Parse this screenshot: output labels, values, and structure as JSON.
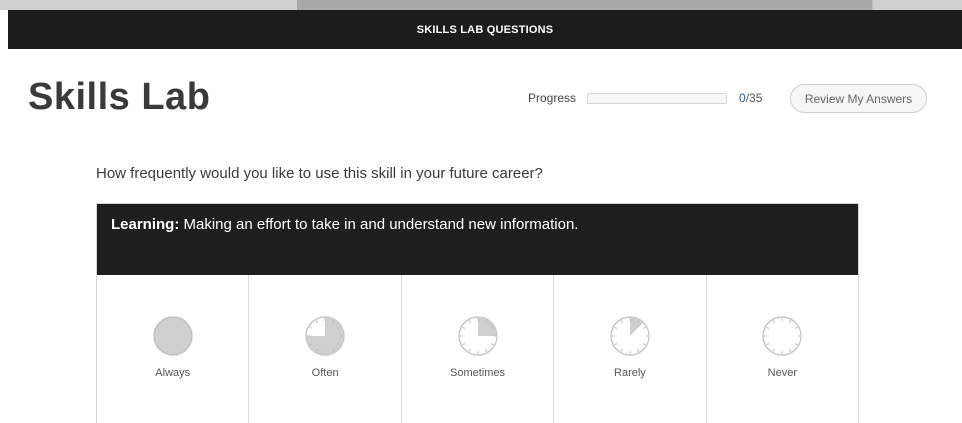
{
  "header": {
    "title": "SKILLS LAB QUESTIONS"
  },
  "page": {
    "title": "Skills Lab"
  },
  "progress": {
    "label": "Progress",
    "current": "0",
    "total": "/35",
    "fraction": 0
  },
  "review_button": {
    "label": "Review My Answers"
  },
  "question": {
    "text": "How frequently would you like to use this skill in your future career?"
  },
  "skill": {
    "name": "Learning:",
    "description": " Making an effort to take in and understand new information."
  },
  "options": [
    {
      "label": "Always",
      "icon": "clock-full-icon",
      "fill": 1.0
    },
    {
      "label": "Often",
      "icon": "clock-three-quarter-icon",
      "fill": 0.75
    },
    {
      "label": "Sometimes",
      "icon": "clock-quarter-icon",
      "fill": 0.25
    },
    {
      "label": "Rarely",
      "icon": "clock-eighth-icon",
      "fill": 0.125
    },
    {
      "label": "Never",
      "icon": "clock-empty-icon",
      "fill": 0
    }
  ],
  "colors": {
    "header_bg": "#1c1c1c",
    "accent": "#1f5fa8",
    "icon_fill": "#cfcfcf",
    "icon_stroke": "#bdbdbd"
  }
}
